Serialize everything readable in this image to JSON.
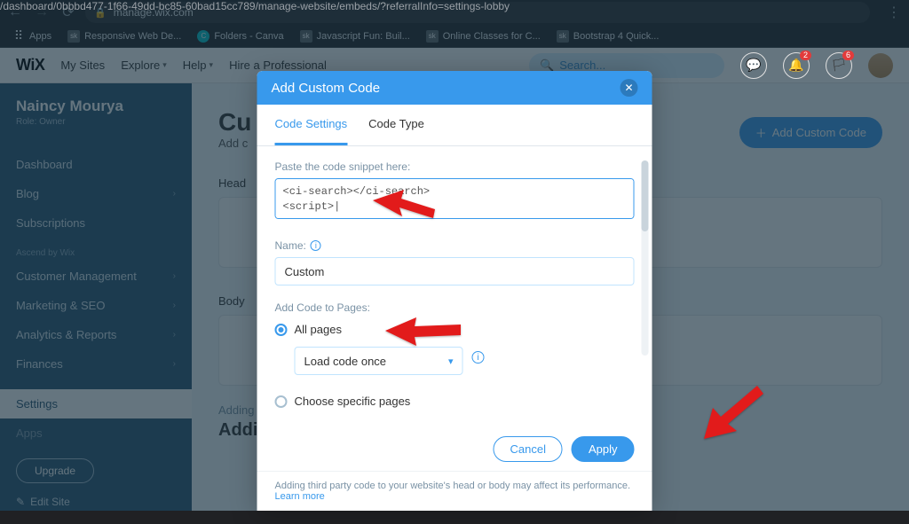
{
  "browser": {
    "url_host": "manage.wix.com",
    "url_path": "/dashboard/0bbbd477-1f66-49dd-bc85-60bad15cc789/manage-website/embeds/?referralInfo=settings-lobby",
    "bookmarks": [
      {
        "label": "Apps",
        "icon": "apps"
      },
      {
        "label": "Responsive Web De...",
        "icon": "sq"
      },
      {
        "label": "Folders - Canva",
        "icon": "canva"
      },
      {
        "label": "Javascript Fun: Buil...",
        "icon": "sq"
      },
      {
        "label": "Online Classes for C...",
        "icon": "sq"
      },
      {
        "label": "Bootstrap 4 Quick...",
        "icon": "sq"
      }
    ]
  },
  "appbar": {
    "logo": "WiX",
    "links": [
      "My Sites",
      "Explore",
      "Help",
      "Hire a Professional"
    ],
    "search_placeholder": "Search...",
    "badge_bell": "2",
    "badge_chat": "6"
  },
  "sidebar": {
    "user_name": "Naincy Mourya",
    "user_role": "Role: Owner",
    "items_top": [
      "Dashboard",
      "Blog",
      "Subscriptions"
    ],
    "ascend_label": "Ascend by Wix",
    "items_mid": [
      "Customer Management",
      "Marketing & SEO",
      "Analytics & Reports",
      "Finances"
    ],
    "settings_label": "Settings",
    "apps_label": "Apps",
    "upgrade": "Upgrade",
    "edit_site": "Edit Site"
  },
  "content": {
    "title_prefix": "Cu",
    "subtitle_prefix": "Add c",
    "head_label": "Head",
    "body_label": "Body",
    "adding_label": "Adding",
    "addi_label": "Addi",
    "add_button": "Add Custom Code"
  },
  "modal": {
    "title": "Add Custom Code",
    "tabs": [
      "Code Settings",
      "Code Type"
    ],
    "paste_label": "Paste the code snippet here:",
    "code_value": "<ci-search></ci-search>\n<script>|",
    "name_label": "Name:",
    "name_value": "Custom",
    "pages_label": "Add Code to Pages:",
    "radio_all": "All pages",
    "load_option": "Load code once",
    "radio_choose": "Choose specific pages",
    "cancel": "Cancel",
    "apply": "Apply",
    "footer_text": "Adding third party code to your website's head or body may affect its performance. ",
    "footer_link": "Learn more"
  }
}
